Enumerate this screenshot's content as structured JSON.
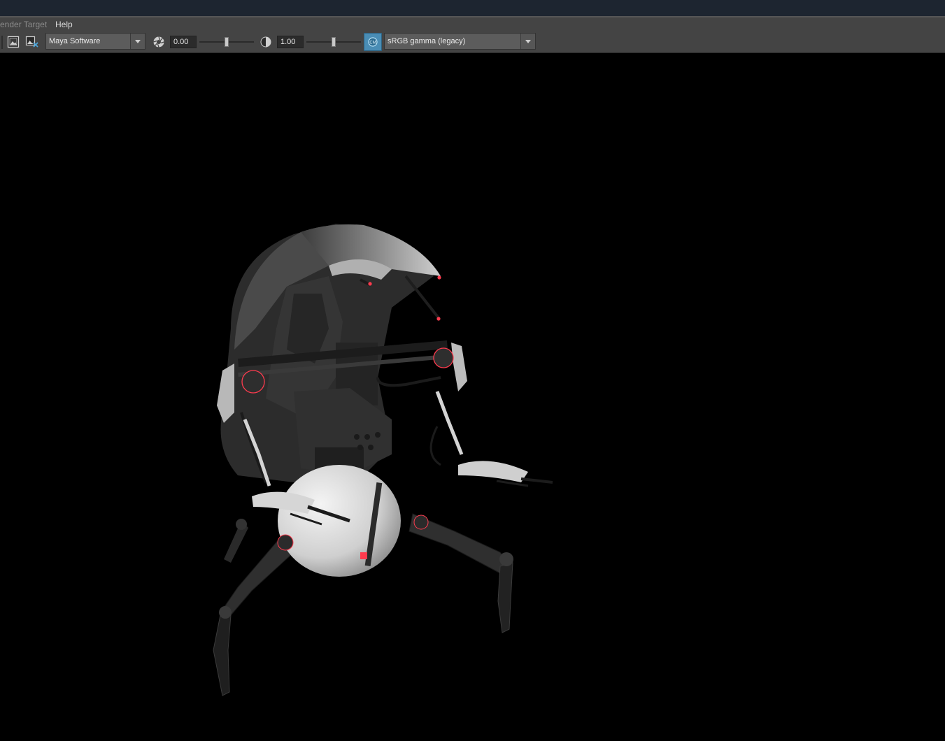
{
  "menubar": {
    "items": [
      {
        "label": "ender Target",
        "state": "dim"
      },
      {
        "label": "Help",
        "state": "active"
      }
    ]
  },
  "toolbar": {
    "render_view_icon": "render-view-icon",
    "remove_image_icon": "remove-image-icon",
    "renderer": {
      "selected": "Maya Software"
    },
    "exposure": {
      "icon": "aperture-icon",
      "value": "0.00",
      "slider_level": 0.5
    },
    "gamma": {
      "icon": "gamma-contrast-icon",
      "value": "1.00",
      "slider_level": 0.5
    },
    "color_management": {
      "icon": "color-management-icon",
      "accent": "#4a8db5"
    },
    "view_transform": {
      "selected": "sRGB gamma (legacy)"
    }
  },
  "viewport": {
    "background": "#000000",
    "subject": "droideka-droid-render",
    "accent": "#ff3b4e"
  }
}
